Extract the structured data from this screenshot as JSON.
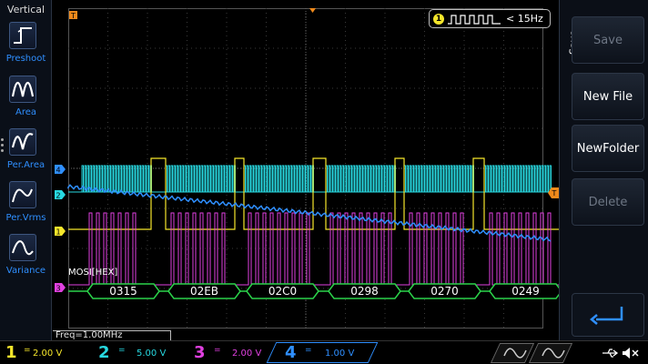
{
  "left_panel": {
    "title": "Vertical",
    "items": [
      {
        "label": "Preshoot",
        "icon": "preshoot-icon"
      },
      {
        "label": "Area",
        "icon": "area-icon"
      },
      {
        "label": "Per.Area",
        "icon": "per-area-icon"
      },
      {
        "label": "Per.Vrms",
        "icon": "per-vrms-icon"
      },
      {
        "label": "Variance",
        "icon": "variance-icon"
      }
    ]
  },
  "screen": {
    "trigger": {
      "channel": "1",
      "text": "< 15Hz",
      "icon": "pulse-width-trigger-icon"
    },
    "trigger_position_marker": "T",
    "trigger_level_marker": "T",
    "frequency": "Freq=1.00MHz",
    "decoder": {
      "label": "MOSI[HEX]",
      "channel_marker": "3",
      "values": [
        "0315",
        "02EB",
        "02C0",
        "0298",
        "0270",
        "0249"
      ]
    },
    "channel_markers": [
      {
        "channel": "4",
        "color": "#2f8fff"
      },
      {
        "channel": "2",
        "color": "#27d8e0"
      },
      {
        "channel": "1",
        "color": "#f5e62b"
      }
    ]
  },
  "right_panel": {
    "title": "Save",
    "buttons": [
      {
        "label": "Save",
        "enabled": false
      },
      {
        "label": "New File",
        "enabled": true
      },
      {
        "label": "NewFolder",
        "enabled": true
      },
      {
        "label": "Delete",
        "enabled": false
      }
    ],
    "enter_icon": "enter-return-icon"
  },
  "bottom_bar": {
    "channels": [
      {
        "num": "1",
        "coupling": "=",
        "scale": "2.00 V",
        "color": "#f5e62b"
      },
      {
        "num": "2",
        "coupling": "=",
        "scale": "5.00 V",
        "color": "#27d8e0"
      },
      {
        "num": "3",
        "coupling": "=",
        "scale": "2.00 V",
        "color": "#e040e0"
      },
      {
        "num": "4",
        "coupling": "=",
        "scale": "1.00 V",
        "color": "#2f8fff"
      }
    ],
    "icons": [
      "usb-icon",
      "speaker-mute-icon"
    ]
  }
}
